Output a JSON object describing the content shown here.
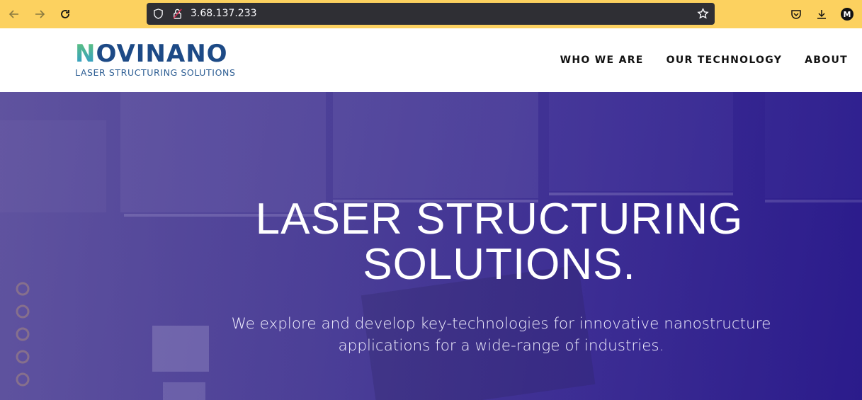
{
  "browser": {
    "url": "3.68.137.233",
    "account_initial": "M",
    "chrome_color": "#fcd15f"
  },
  "site": {
    "logo_text": "NOVINANO",
    "logo_tagline": "LASER STRUCTURING SOLUTIONS",
    "nav": [
      {
        "label": "WHO WE ARE"
      },
      {
        "label": "OUR TECHNOLOGY"
      },
      {
        "label": "ABOUT"
      }
    ]
  },
  "hero": {
    "title_line1": "LASER STRUCTURING",
    "title_line2": "SOLUTIONS.",
    "subtitle": "We explore and develop key-technologies for innovative nanostructure applications for a wide-range of industries."
  },
  "icons": {
    "back": "back-arrow-icon",
    "forward": "forward-arrow-icon",
    "reload": "reload-icon",
    "shield": "tracking-shield-icon",
    "lock": "insecure-lock-icon",
    "bookmark": "bookmark-star-icon",
    "pocket": "pocket-icon",
    "downloads": "download-icon"
  }
}
